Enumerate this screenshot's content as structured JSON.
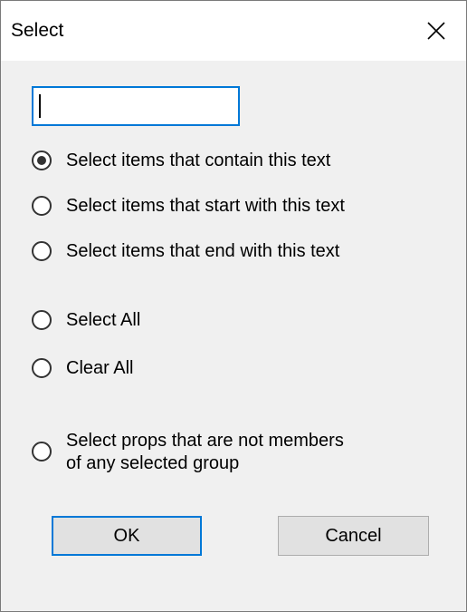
{
  "window": {
    "title": "Select",
    "close_icon": "close-icon"
  },
  "search": {
    "value": "",
    "placeholder": ""
  },
  "options": [
    {
      "label": "Select items that contain this text",
      "checked": true
    },
    {
      "label": "Select items that start with this text",
      "checked": false
    },
    {
      "label": "Select items that end with this text",
      "checked": false
    },
    {
      "label": "Select All",
      "checked": false
    },
    {
      "label": "Clear All",
      "checked": false
    },
    {
      "label_line1": "Select props that are not members",
      "label_line2": "of any selected group",
      "checked": false
    }
  ],
  "buttons": {
    "ok_label": "OK",
    "cancel_label": "Cancel"
  },
  "colors": {
    "accent": "#0078d7",
    "dialog_background": "#f0f0f0",
    "titlebar_background": "#ffffff"
  }
}
